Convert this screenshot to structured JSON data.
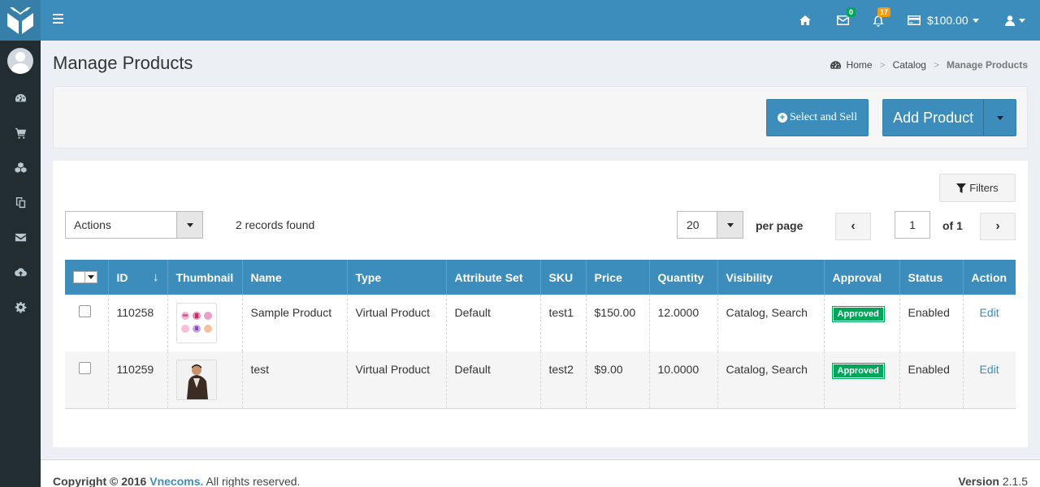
{
  "header": {
    "mail_badge": "0",
    "notif_badge": "17",
    "balance": "$100.00"
  },
  "sidebar": {
    "icons": [
      "dashboard-icon",
      "cart-icon",
      "cubes-icon",
      "copy-icon",
      "envelope-icon",
      "cloud-upload-icon",
      "gear-icon"
    ]
  },
  "page": {
    "title": "Manage Products",
    "breadcrumb": [
      "Home",
      "Catalog",
      "Manage Products"
    ]
  },
  "toolbar": {
    "select_sell_label": "Select and Sell",
    "add_product_label": "Add Product",
    "filters_label": "Filters"
  },
  "grid": {
    "actions_value": "Actions",
    "records_text": "2 records found",
    "per_page_value": "20",
    "per_page_label": "per page",
    "page_value": "1",
    "page_of": "of 1",
    "prev_symbol": "‹",
    "next_symbol": "›",
    "sort_symbol": "↓",
    "columns": [
      "ID",
      "Thumbnail",
      "Name",
      "Type",
      "Attribute Set",
      "SKU",
      "Price",
      "Quantity",
      "Visibility",
      "Approval",
      "Status",
      "Action"
    ],
    "rows": [
      {
        "id": "110258",
        "name": "Sample Product",
        "type": "Virtual Product",
        "attribute_set": "Default",
        "sku": "test1",
        "price": "$150.00",
        "quantity": "12.0000",
        "visibility": "Catalog, Search",
        "approval": "Approved",
        "status": "Enabled",
        "action": "Edit"
      },
      {
        "id": "110259",
        "name": "test",
        "type": "Virtual Product",
        "attribute_set": "Default",
        "sku": "test2",
        "price": "$9.00",
        "quantity": "10.0000",
        "visibility": "Catalog, Search",
        "approval": "Approved",
        "status": "Enabled",
        "action": "Edit"
      }
    ]
  },
  "footer": {
    "copyright_prefix": "Copyright © 2016",
    "brand": "Vnecoms.",
    "rights": "All rights reserved.",
    "version_label": "Version",
    "version_value": "2.1.5"
  },
  "colors": {
    "primary": "#3c8dbc",
    "sidebar": "#222d32",
    "approved": "#00a65a",
    "badge_green": "#00a65a",
    "badge_orange": "#f39c12"
  }
}
